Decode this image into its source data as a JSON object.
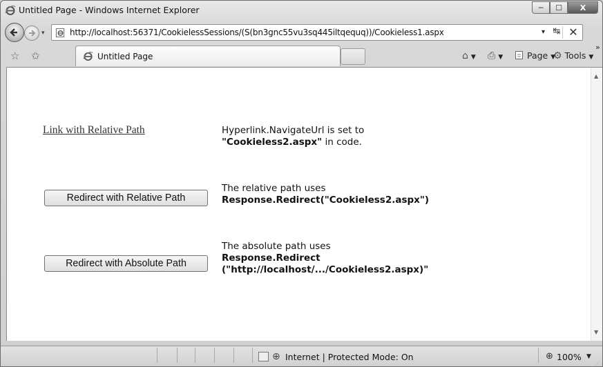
{
  "window": {
    "title": "Untitled Page - Windows Internet Explorer",
    "minimize": "─",
    "maximize": "☐",
    "close": "X"
  },
  "nav": {
    "address": "http://localhost:56371/CookielessSessions/(S(bn3gnc55vu3sq445iltqequq))/Cookieless1.aspx",
    "dropdown": "▾",
    "refresh": "↹",
    "stop": "✕"
  },
  "tabs": {
    "active_tab": "Untitled Page"
  },
  "commands": {
    "home_glyph": "⌂",
    "print_glyph": "⎙",
    "page_label": "Page",
    "tools_label": "Tools",
    "more": "»"
  },
  "page": {
    "link_text": "Link with Relative Path",
    "desc1_line1": "Hyperlink.NavigateUrl is set to",
    "desc1_bold": "\"Cookieless2.aspx\"",
    "desc1_tail": " in code.",
    "button1_label": "Redirect with Relative Path",
    "desc2_line1": "The relative path uses",
    "desc2_bold": "Response.Redirect(\"Cookieless2.aspx\")",
    "button2_label": "Redirect with Absolute Path",
    "desc3_line1": "The absolute path uses",
    "desc3_bold1": "Response.Redirect",
    "desc3_bold2": "(\"http://localhost/.../Cookieless2.aspx)\""
  },
  "status": {
    "zone": "Internet | Protected Mode: On",
    "zoom": "100%"
  }
}
